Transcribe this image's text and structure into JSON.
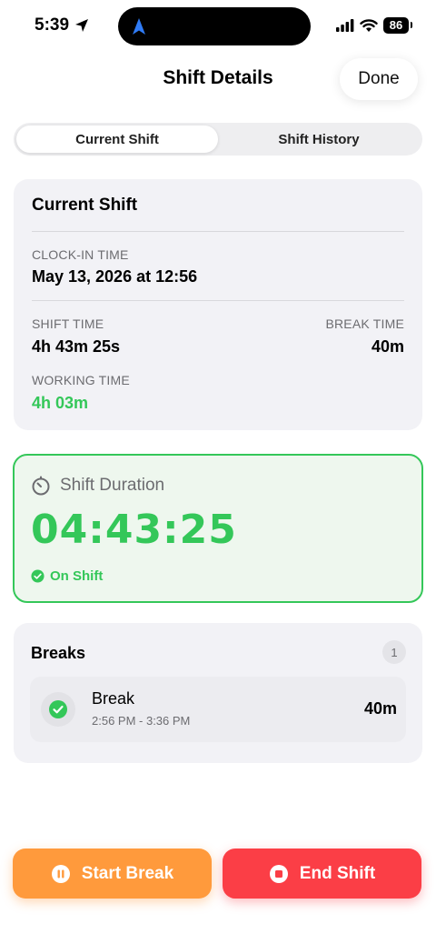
{
  "status_bar": {
    "time": "5:39",
    "battery": "86"
  },
  "nav": {
    "title": "Shift Details",
    "done_label": "Done"
  },
  "tabs": [
    {
      "label": "Current Shift",
      "active": true
    },
    {
      "label": "Shift History",
      "active": false
    }
  ],
  "current_shift": {
    "title": "Current Shift",
    "clock_in_label": "CLOCK-IN TIME",
    "clock_in_value": "May 13, 2026 at 12:56",
    "shift_time_label": "SHIFT TIME",
    "shift_time_value": "4h 43m 25s",
    "break_time_label": "BREAK TIME",
    "break_time_value": "40m",
    "working_time_label": "WORKING TIME",
    "working_time_value": "4h 03m"
  },
  "duration": {
    "title": "Shift Duration",
    "timer": "04:43:25",
    "status": "On Shift"
  },
  "breaks": {
    "title": "Breaks",
    "count": "1",
    "items": [
      {
        "name": "Break",
        "range": "2:56 PM - 3:36 PM",
        "duration": "40m"
      }
    ]
  },
  "actions": {
    "start_break": "Start Break",
    "end_shift": "End Shift"
  },
  "colors": {
    "green": "#34c759",
    "orange": "#ff9a3c",
    "red": "#fb3e46"
  },
  "icons": [
    "location-arrow-icon",
    "navigation-icon",
    "signal-icon",
    "wifi-icon",
    "battery-icon",
    "timer-icon",
    "check-circle-icon",
    "pause-icon",
    "stop-icon"
  ]
}
